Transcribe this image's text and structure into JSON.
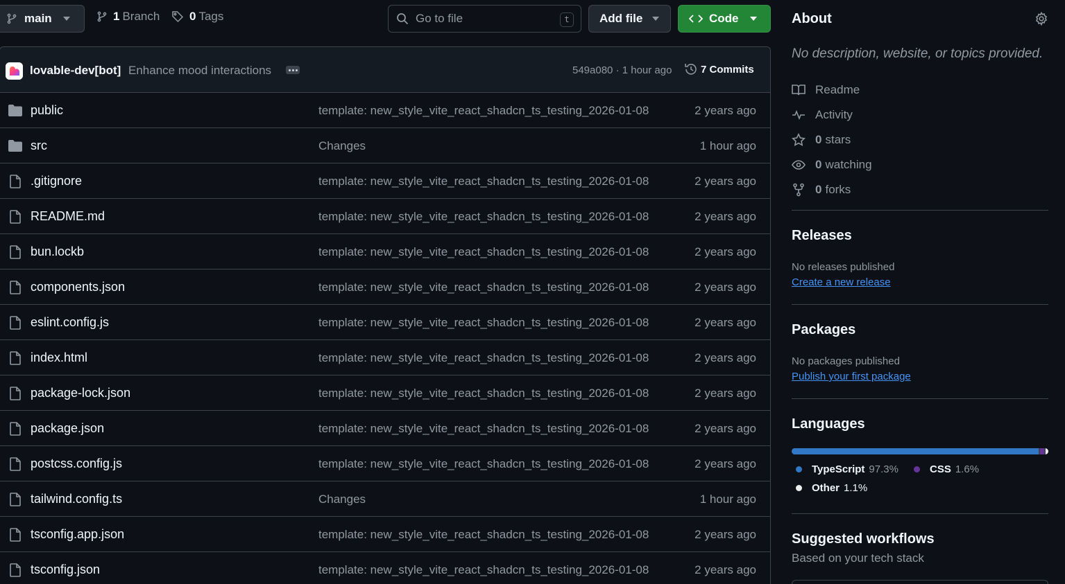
{
  "toolbar": {
    "branch": "main",
    "branches_count": "1",
    "branches_label": "Branch",
    "tags_count": "0",
    "tags_label": "Tags",
    "search_placeholder": "Go to file",
    "search_shortcut": "t",
    "add_file_label": "Add file",
    "code_label": "Code",
    "code_button_color": "#238636"
  },
  "commit": {
    "author": "lovable-dev[bot]",
    "message": "Enhance mood interactions",
    "hash_time": "549a080 · 1 hour ago",
    "commits_label": "7 Commits"
  },
  "files": [
    {
      "name": "public",
      "type": "folder",
      "message": "template: new_style_vite_react_shadcn_ts_testing_2026-01-08",
      "age": "2 years ago"
    },
    {
      "name": "src",
      "type": "folder",
      "message": "Changes",
      "age": "1 hour ago"
    },
    {
      "name": ".gitignore",
      "type": "file",
      "message": "template: new_style_vite_react_shadcn_ts_testing_2026-01-08",
      "age": "2 years ago"
    },
    {
      "name": "README.md",
      "type": "file",
      "message": "template: new_style_vite_react_shadcn_ts_testing_2026-01-08",
      "age": "2 years ago"
    },
    {
      "name": "bun.lockb",
      "type": "file",
      "message": "template: new_style_vite_react_shadcn_ts_testing_2026-01-08",
      "age": "2 years ago"
    },
    {
      "name": "components.json",
      "type": "file",
      "message": "template: new_style_vite_react_shadcn_ts_testing_2026-01-08",
      "age": "2 years ago"
    },
    {
      "name": "eslint.config.js",
      "type": "file",
      "message": "template: new_style_vite_react_shadcn_ts_testing_2026-01-08",
      "age": "2 years ago"
    },
    {
      "name": "index.html",
      "type": "file",
      "message": "template: new_style_vite_react_shadcn_ts_testing_2026-01-08",
      "age": "2 years ago"
    },
    {
      "name": "package-lock.json",
      "type": "file",
      "message": "template: new_style_vite_react_shadcn_ts_testing_2026-01-08",
      "age": "2 years ago"
    },
    {
      "name": "package.json",
      "type": "file",
      "message": "template: new_style_vite_react_shadcn_ts_testing_2026-01-08",
      "age": "2 years ago"
    },
    {
      "name": "postcss.config.js",
      "type": "file",
      "message": "template: new_style_vite_react_shadcn_ts_testing_2026-01-08",
      "age": "2 years ago"
    },
    {
      "name": "tailwind.config.ts",
      "type": "file",
      "message": "Changes",
      "age": "1 hour ago"
    },
    {
      "name": "tsconfig.app.json",
      "type": "file",
      "message": "template: new_style_vite_react_shadcn_ts_testing_2026-01-08",
      "age": "2 years ago"
    },
    {
      "name": "tsconfig.json",
      "type": "file",
      "message": "template: new_style_vite_react_shadcn_ts_testing_2026-01-08",
      "age": "2 years ago"
    }
  ],
  "about": {
    "title": "About",
    "description": "No description, website, or topics provided.",
    "readme": "Readme",
    "activity": "Activity",
    "stars_count": "0",
    "stars_label": "stars",
    "watching_count": "0",
    "watching_label": "watching",
    "forks_count": "0",
    "forks_label": "forks"
  },
  "releases": {
    "title": "Releases",
    "subtitle": "No releases published",
    "link": "Create a new release"
  },
  "packages": {
    "title": "Packages",
    "subtitle": "No packages published",
    "link": "Publish your first package"
  },
  "languages": {
    "title": "Languages",
    "items": [
      {
        "name": "TypeScript",
        "percent": "97.3%",
        "value": 97.3,
        "color": "#3178c6"
      },
      {
        "name": "CSS",
        "percent": "1.6%",
        "value": 1.6,
        "color": "#663399"
      },
      {
        "name": "Other",
        "percent": "1.1%",
        "value": 1.1,
        "color": "#ededed"
      }
    ]
  },
  "workflows": {
    "title": "Suggested workflows",
    "subtitle": "Based on your tech stack"
  }
}
